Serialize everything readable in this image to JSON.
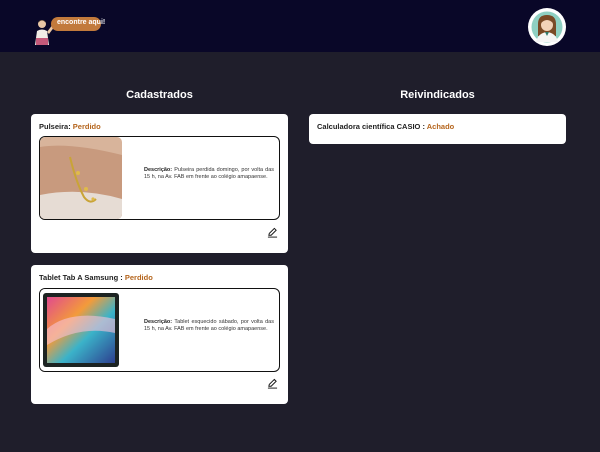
{
  "header": {
    "logo_text": "encontre aqui!"
  },
  "columns": {
    "registered_title": "Cadastrados",
    "claimed_title": "Reivindicados"
  },
  "registered": [
    {
      "name": "Pulseira",
      "separator": ": ",
      "status": "Perdido",
      "description_label": "Descrição:",
      "description": "Pulseira perdida domingo, por volta das 15 h, na Av. FAB em frente ao colégio amapaense."
    },
    {
      "name": "Tablet Tab A Samsung",
      "separator": " : ",
      "status": "Perdido",
      "description_label": "Descrição:",
      "description": "Tablet esquecido sábado, por volta das 15 h, na Av. FAB em frente ao colégio amapaense."
    }
  ],
  "claimed": [
    {
      "name": "Calculadora científica CASIO",
      "separator": " : ",
      "status": "Achado"
    }
  ],
  "icons": {
    "edit": "pencil-icon",
    "avatar": "user-avatar",
    "logo": "logo"
  },
  "colors": {
    "header_bg": "#090728",
    "page_bg": "#1f1e2b",
    "status": "#b5651d"
  }
}
